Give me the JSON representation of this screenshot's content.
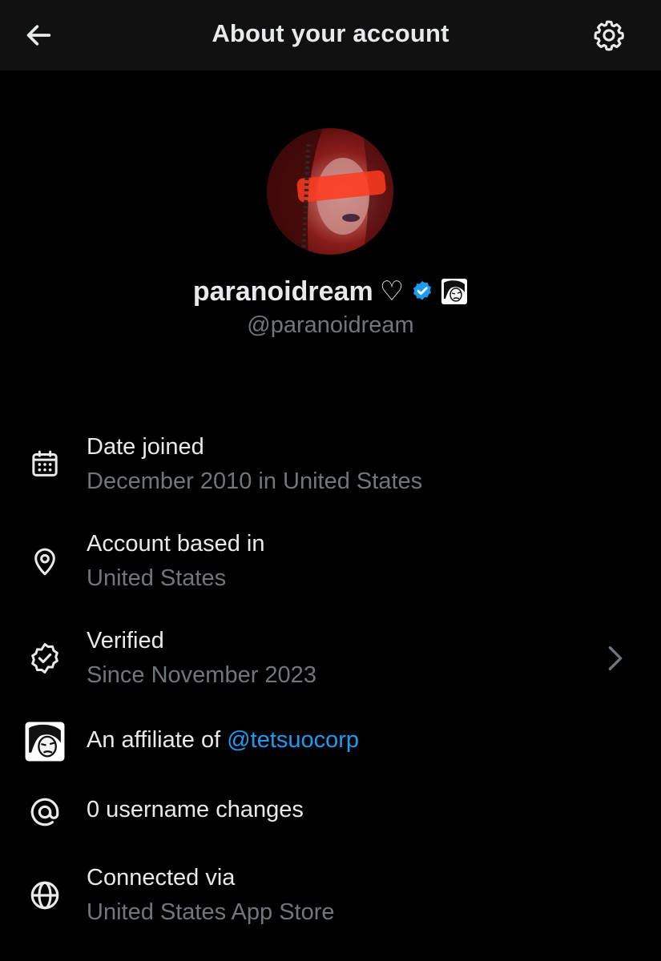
{
  "header": {
    "title": "About your account",
    "back_icon": "arrow-left-icon",
    "settings_icon": "gear-icon"
  },
  "profile": {
    "display_name": "paranoidream",
    "heart": "♡",
    "verified_badge": "verified-check-icon",
    "affiliate_badge": "affiliate-badge-icon",
    "handle": "@paranoidream"
  },
  "details": {
    "date_joined": {
      "icon": "calendar-icon",
      "label": "Date joined",
      "value": "December 2010 in United States"
    },
    "account_based": {
      "icon": "location-pin-icon",
      "label": "Account based in",
      "value": "United States"
    },
    "verified": {
      "icon": "verified-badge-outline-icon",
      "label": "Verified",
      "value": "Since November 2023",
      "chevron": "chevron-right-icon"
    },
    "affiliate": {
      "icon": "affiliate-avatar-icon",
      "prefix": "An affiliate of",
      "link": "@tetsuocorp"
    },
    "username_changes": {
      "icon": "at-sign-icon",
      "label": "0 username changes"
    },
    "connected": {
      "icon": "globe-icon",
      "label": "Connected via",
      "value": "United States App Store"
    }
  },
  "colors": {
    "background": "#000000",
    "header_background": "#111111",
    "primary_text": "#e7e9ea",
    "secondary_text": "#71767b",
    "link": "#1d9bf0",
    "verified": "#1d9bf0"
  }
}
